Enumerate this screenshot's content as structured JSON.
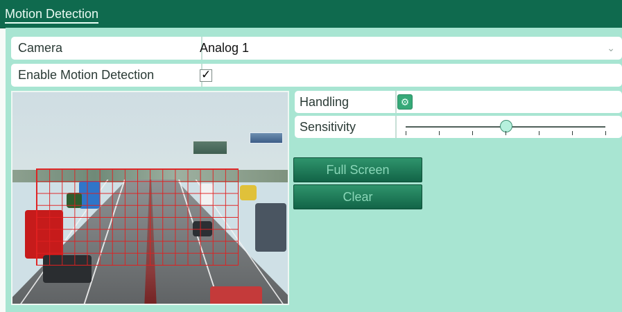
{
  "page": {
    "title": "Motion Detection"
  },
  "camera": {
    "label": "Camera",
    "value": "Analog 1",
    "icon": "chevron-down-icon"
  },
  "enable": {
    "label": "Enable Motion Detection",
    "checked": true,
    "icon": "checkmark-icon"
  },
  "handling": {
    "label": "Handling",
    "icon": "gear-icon"
  },
  "sensitivity": {
    "label": "Sensitivity",
    "level": 0.5
  },
  "buttons": {
    "full_screen": "Full Screen",
    "clear": "Clear"
  },
  "colors": {
    "titlebar": "#0f6a4e",
    "background": "#a8e5d2",
    "grid": "#e02020",
    "button": "#126447"
  }
}
